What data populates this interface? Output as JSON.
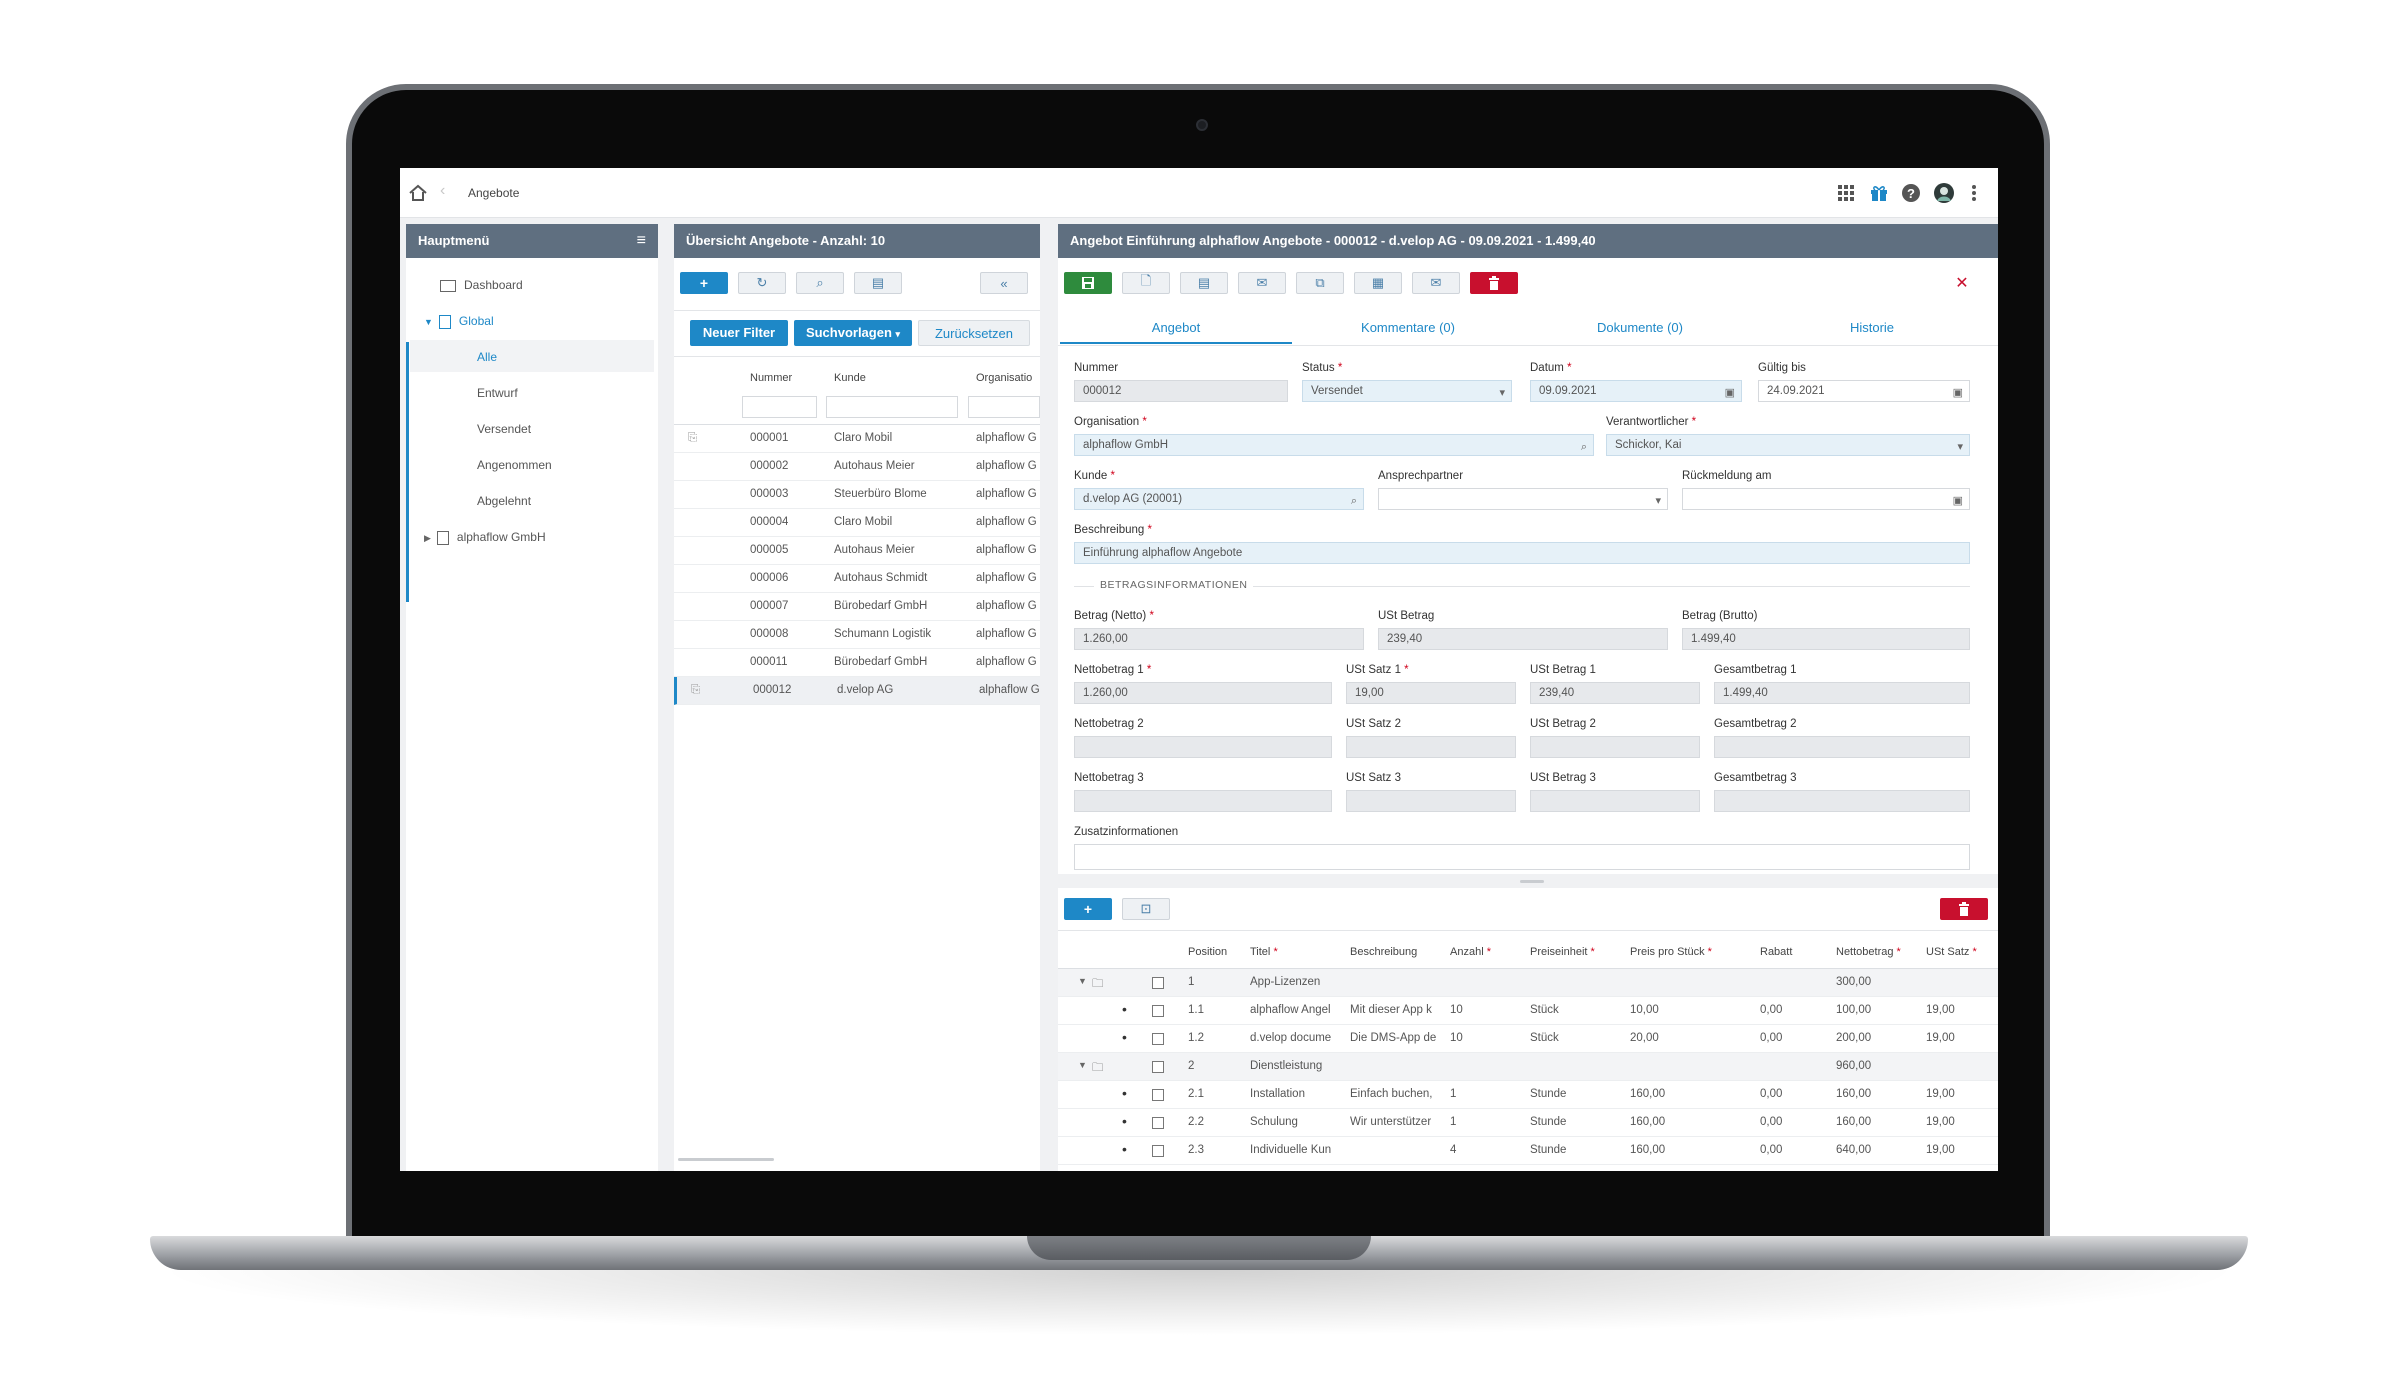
{
  "breadcrumb": {
    "current": "Angebote"
  },
  "topbar_icons": [
    "apps-grid-icon",
    "gift-icon",
    "help-icon",
    "avatar",
    "more-vertical-icon"
  ],
  "menu": {
    "title": "Hauptmenü",
    "items": {
      "dashboard": "Dashboard",
      "global": "Global",
      "alle": "Alle",
      "entwurf": "Entwurf",
      "versendet": "Versendet",
      "angenommen": "Angenommen",
      "abgelehnt": "Abgelehnt",
      "alphaflow": "alphaflow GmbH"
    }
  },
  "overview": {
    "title": "Übersicht Angebote - Anzahl: 10",
    "buttons": {
      "new_filter": "Neuer Filter",
      "templates": "Suchvorlagen",
      "reset": "Zurücksetzen"
    },
    "columns": [
      "Nummer",
      "Kunde",
      "Organisatio"
    ],
    "rows": [
      {
        "nummer": "000001",
        "kunde": "Claro Mobil",
        "org": "alphaflow G",
        "attach": true
      },
      {
        "nummer": "000002",
        "kunde": "Autohaus Meier",
        "org": "alphaflow G",
        "attach": false
      },
      {
        "nummer": "000003",
        "kunde": "Steuerbüro Blome",
        "org": "alphaflow G",
        "attach": false
      },
      {
        "nummer": "000004",
        "kunde": "Claro Mobil",
        "org": "alphaflow G",
        "attach": false
      },
      {
        "nummer": "000005",
        "kunde": "Autohaus Meier",
        "org": "alphaflow G",
        "attach": false
      },
      {
        "nummer": "000006",
        "kunde": "Autohaus Schmidt",
        "org": "alphaflow G",
        "attach": false
      },
      {
        "nummer": "000007",
        "kunde": "Bürobedarf GmbH",
        "org": "alphaflow G",
        "attach": false
      },
      {
        "nummer": "000008",
        "kunde": "Schumann Logistik",
        "org": "alphaflow G",
        "attach": false
      },
      {
        "nummer": "000011",
        "kunde": "Bürobedarf GmbH",
        "org": "alphaflow G",
        "attach": false
      },
      {
        "nummer": "000012",
        "kunde": "d.velop AG",
        "org": "alphaflow G",
        "attach": true
      }
    ]
  },
  "detail": {
    "title": "Angebot Einführung alphaflow Angebote - 000012 - d.velop AG - 09.09.2021 - 1.499,40",
    "tabs": [
      "Angebot",
      "Kommentare (0)",
      "Dokumente (0)",
      "Historie"
    ],
    "form": {
      "nummer": {
        "label": "Nummer",
        "value": "000012"
      },
      "status": {
        "label": "Status",
        "value": "Versendet"
      },
      "datum": {
        "label": "Datum",
        "value": "09.09.2021"
      },
      "gueltig": {
        "label": "Gültig bis",
        "value": "24.09.2021"
      },
      "organisation": {
        "label": "Organisation",
        "value": "alphaflow GmbH"
      },
      "verantwortlicher": {
        "label": "Verantwortlicher",
        "value": "Schickor, Kai"
      },
      "kunde": {
        "label": "Kunde",
        "value": "d.velop AG (20001)"
      },
      "ansprechpartner": {
        "label": "Ansprechpartner",
        "value": ""
      },
      "rueckmeldung": {
        "label": "Rückmeldung am",
        "value": ""
      },
      "beschreibung": {
        "label": "Beschreibung",
        "value": "Einführung alphaflow Angebote"
      },
      "section": "BETRAGSINFORMATIONEN",
      "betrag_netto": {
        "label": "Betrag (Netto)",
        "value": "1.260,00"
      },
      "ust_betrag": {
        "label": "USt Betrag",
        "value": "239,40"
      },
      "betrag_brutto": {
        "label": "Betrag (Brutto)",
        "value": "1.499,40"
      },
      "netto1": {
        "label": "Nettobetrag 1",
        "value": "1.260,00"
      },
      "ustsatz1": {
        "label": "USt Satz 1",
        "value": "19,00"
      },
      "ustbetrag1": {
        "label": "USt Betrag 1",
        "value": "239,40"
      },
      "gesamt1": {
        "label": "Gesamtbetrag 1",
        "value": "1.499,40"
      },
      "netto2": {
        "label": "Nettobetrag 2",
        "value": ""
      },
      "ustsatz2": {
        "label": "USt Satz 2",
        "value": ""
      },
      "ustbetrag2": {
        "label": "USt Betrag 2",
        "value": ""
      },
      "gesamt2": {
        "label": "Gesamtbetrag 2",
        "value": ""
      },
      "netto3": {
        "label": "Nettobetrag 3",
        "value": ""
      },
      "ustsatz3": {
        "label": "USt Satz 3",
        "value": ""
      },
      "ustbetrag3": {
        "label": "USt Betrag 3",
        "value": ""
      },
      "gesamt3": {
        "label": "Gesamtbetrag 3",
        "value": ""
      },
      "zusatz": {
        "label": "Zusatzinformationen",
        "value": ""
      }
    }
  },
  "positions": {
    "columns": [
      "Position",
      "Titel",
      "Beschreibung",
      "Anzahl",
      "Preiseinheit",
      "Preis pro Stück",
      "Rabatt",
      "Nettobetrag",
      "USt Satz"
    ],
    "rows": [
      {
        "group": true,
        "pos": "1",
        "titel": "App-Lizenzen",
        "beschreibung": "",
        "anzahl": "",
        "einheit": "",
        "preis": "",
        "rabatt": "",
        "netto": "300,00",
        "ust": ""
      },
      {
        "group": false,
        "pos": "1.1",
        "titel": "alphaflow Angel",
        "beschreibung": "Mit dieser App k",
        "anzahl": "10",
        "einheit": "Stück",
        "preis": "10,00",
        "rabatt": "0,00",
        "netto": "100,00",
        "ust": "19,00"
      },
      {
        "group": false,
        "pos": "1.2",
        "titel": "d.velop docume",
        "beschreibung": "Die DMS-App de",
        "anzahl": "10",
        "einheit": "Stück",
        "preis": "20,00",
        "rabatt": "0,00",
        "netto": "200,00",
        "ust": "19,00"
      },
      {
        "group": true,
        "pos": "2",
        "titel": "Dienstleistung",
        "beschreibung": "",
        "anzahl": "",
        "einheit": "",
        "preis": "",
        "rabatt": "",
        "netto": "960,00",
        "ust": ""
      },
      {
        "group": false,
        "pos": "2.1",
        "titel": "Installation",
        "beschreibung": "Einfach buchen,",
        "anzahl": "1",
        "einheit": "Stunde",
        "preis": "160,00",
        "rabatt": "0,00",
        "netto": "160,00",
        "ust": "19,00"
      },
      {
        "group": false,
        "pos": "2.2",
        "titel": "Schulung",
        "beschreibung": "Wir unterstützer",
        "anzahl": "1",
        "einheit": "Stunde",
        "preis": "160,00",
        "rabatt": "0,00",
        "netto": "160,00",
        "ust": "19,00"
      },
      {
        "group": false,
        "pos": "2.3",
        "titel": "Individuelle Kun",
        "beschreibung": "",
        "anzahl": "4",
        "einheit": "Stunde",
        "preis": "160,00",
        "rabatt": "0,00",
        "netto": "640,00",
        "ust": "19,00"
      }
    ]
  },
  "colors": {
    "header": "#5f6f80",
    "accent": "#1e88c7",
    "save": "#2e8b3d",
    "delete": "#c8102e"
  }
}
